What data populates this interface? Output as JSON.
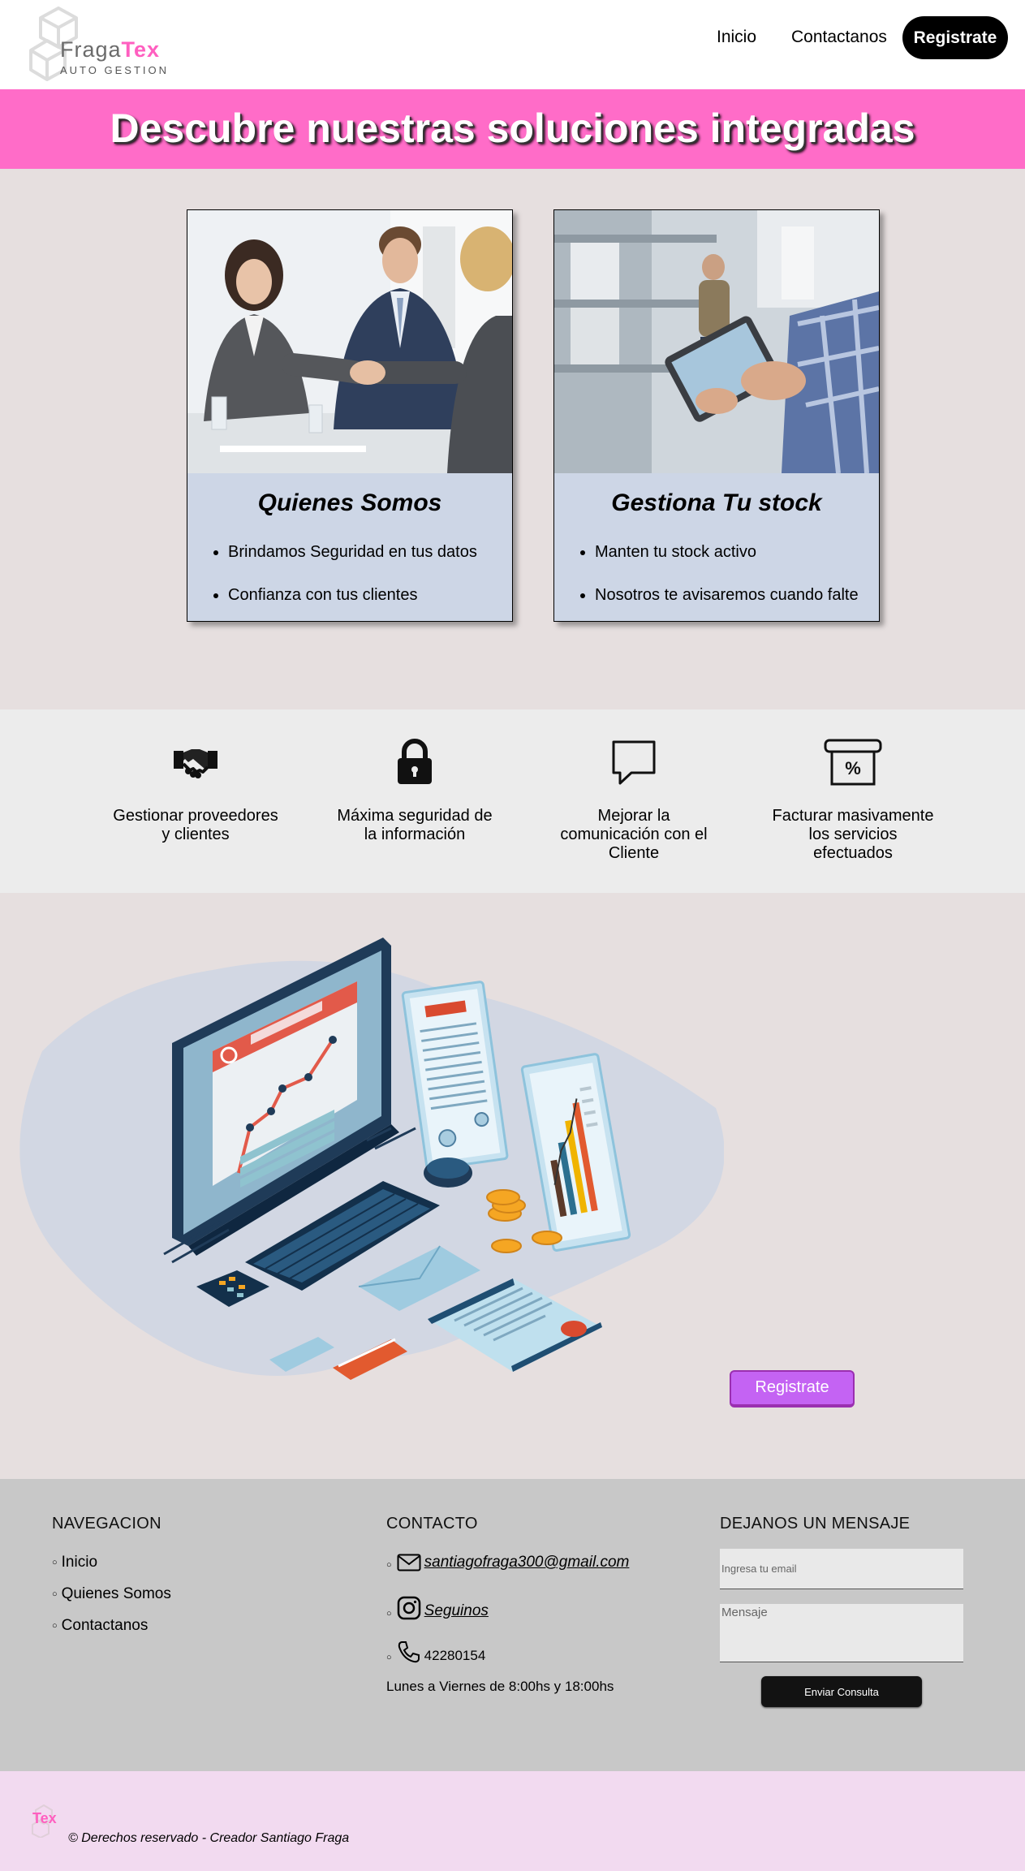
{
  "brand": {
    "name_part1": "Fraga",
    "name_part2": "Tex",
    "tagline": "AUTO GESTION"
  },
  "nav": {
    "links": [
      "Inicio",
      "Contactanos"
    ],
    "register_label": "Registrate"
  },
  "banner": {
    "title": "Descubre nuestras soluciones integradas"
  },
  "cards": [
    {
      "title": "Quienes Somos",
      "items": [
        "Brindamos Seguridad en tus datos",
        "Confianza con tus clientes"
      ]
    },
    {
      "title": "Gestiona Tu stock",
      "items": [
        "Manten tu stock activo",
        "Nosotros te avisaremos cuando falte"
      ]
    }
  ],
  "features": [
    {
      "icon": "handshake-icon",
      "text": "Gestionar proveedores y clientes"
    },
    {
      "icon": "lock-icon",
      "text": "Máxima seguridad de la información"
    },
    {
      "icon": "speech-bubble-icon",
      "text": "Mejorar la comunicación con el Cliente"
    },
    {
      "icon": "receipt-percent-icon",
      "text": "Facturar masivamente los servicios efectuados"
    }
  ],
  "cta": {
    "label": "Registrate"
  },
  "footer": {
    "nav_title": "NAVEGACION",
    "nav_items": [
      "Inicio",
      "Quienes Somos",
      "Contactanos"
    ],
    "contact_title": "CONTACTO",
    "email": "santiagofraga300@gmail.com",
    "social_label": "Seguinos",
    "phone": "42280154",
    "hours": "Lunes a Viernes de 8:00hs y 18:00hs",
    "message_title": "DEJANOS UN MENSAJE",
    "email_placeholder": "Ingresa tu email",
    "message_placeholder": "Mensaje",
    "send_label": "Enviar Consulta"
  },
  "copyright": {
    "logo_text": "Tex",
    "text": "© Derechos reservado - Creador Santiago Fraga"
  },
  "colors": {
    "banner": "#ff6cc8",
    "page_bg": "#e6dfdf",
    "card_bg": "#cdd6e6",
    "features_bg": "#ececec",
    "footer_bg": "#c8c8c8",
    "copyright_bg": "#f2daf0",
    "cta": "#c463f3",
    "brand_accent": "#ff5fc0"
  }
}
